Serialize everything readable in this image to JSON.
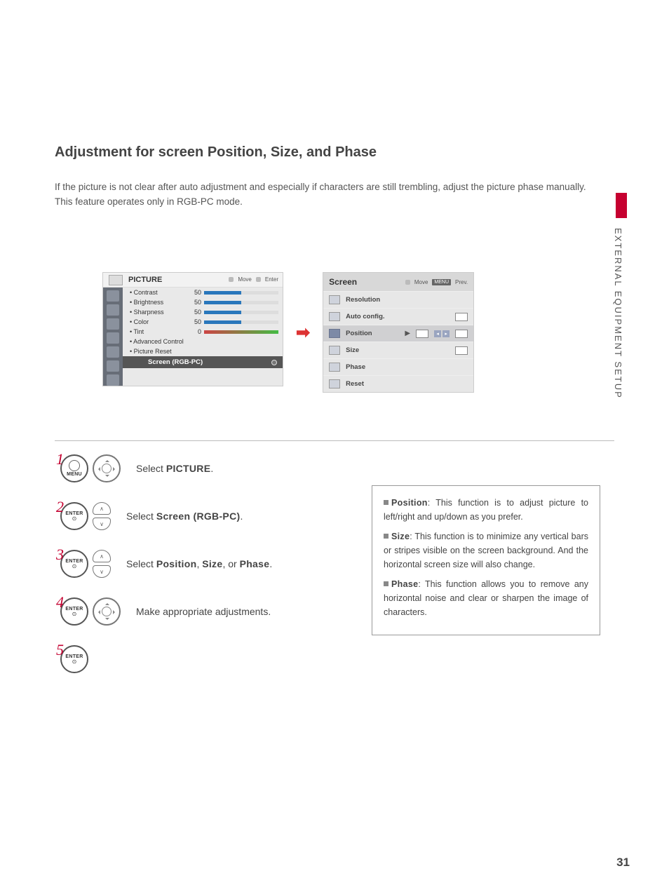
{
  "title": "Adjustment for screen Position, Size, and Phase",
  "intro_line1": "If the picture is not clear after auto adjustment and especially if characters are still trembling, adjust the picture phase manually.",
  "intro_line2": "This feature operates only in RGB-PC mode.",
  "side_section": "EXTERNAL EQUIPMENT SETUP",
  "page_number": "31",
  "osd_picture": {
    "title": "PICTURE",
    "hint_move": "Move",
    "hint_enter": "Enter",
    "rows": [
      {
        "label": "• Contrast",
        "value": "50"
      },
      {
        "label": "• Brightness",
        "value": "50"
      },
      {
        "label": "• Sharpness",
        "value": "50"
      },
      {
        "label": "• Color",
        "value": "50"
      }
    ],
    "tint": {
      "label": "• Tint",
      "value": "0"
    },
    "adv": "• Advanced Control",
    "reset": "• Picture Reset",
    "selected": "Screen (RGB-PC)"
  },
  "osd_screen": {
    "title": "Screen",
    "hint_move": "Move",
    "hint_prev": "Prev.",
    "menu_badge": "MENU",
    "items": {
      "resolution": "Resolution",
      "auto": "Auto config.",
      "position": "Position",
      "size": "Size",
      "phase": "Phase",
      "reset": "Reset"
    }
  },
  "steps": [
    {
      "num": "1",
      "btn": "MENU",
      "pad": "full",
      "pre": "Select ",
      "bold": "PICTURE",
      "post": "."
    },
    {
      "num": "2",
      "btn": "ENTER",
      "pad": "updown",
      "pre": "Select ",
      "bold": "Screen (RGB-PC)",
      "post": "."
    },
    {
      "num": "3",
      "btn": "ENTER",
      "pad": "updown",
      "pre": "Select ",
      "bold": "Position",
      "mid": ", ",
      "bold2": "Size",
      "mid2": ", or ",
      "bold3": "Phase",
      "post": "."
    },
    {
      "num": "4",
      "btn": "ENTER",
      "pad": "full",
      "pre": "Make appropriate adjustments.",
      "bold": "",
      "post": ""
    },
    {
      "num": "5",
      "btn": "ENTER",
      "pad": "none",
      "pre": "",
      "bold": "",
      "post": ""
    }
  ],
  "info": [
    {
      "term": "Position",
      "text": ": This function is to adjust picture to left/right and up/down as you prefer."
    },
    {
      "term": "Size",
      "text": ": This function is to minimize any vertical bars or stripes visible on the screen background. And the horizontal screen size will also change."
    },
    {
      "term": "Phase",
      "text": ": This function allows you to remove any horizontal noise and clear or sharpen the image of characters."
    }
  ]
}
